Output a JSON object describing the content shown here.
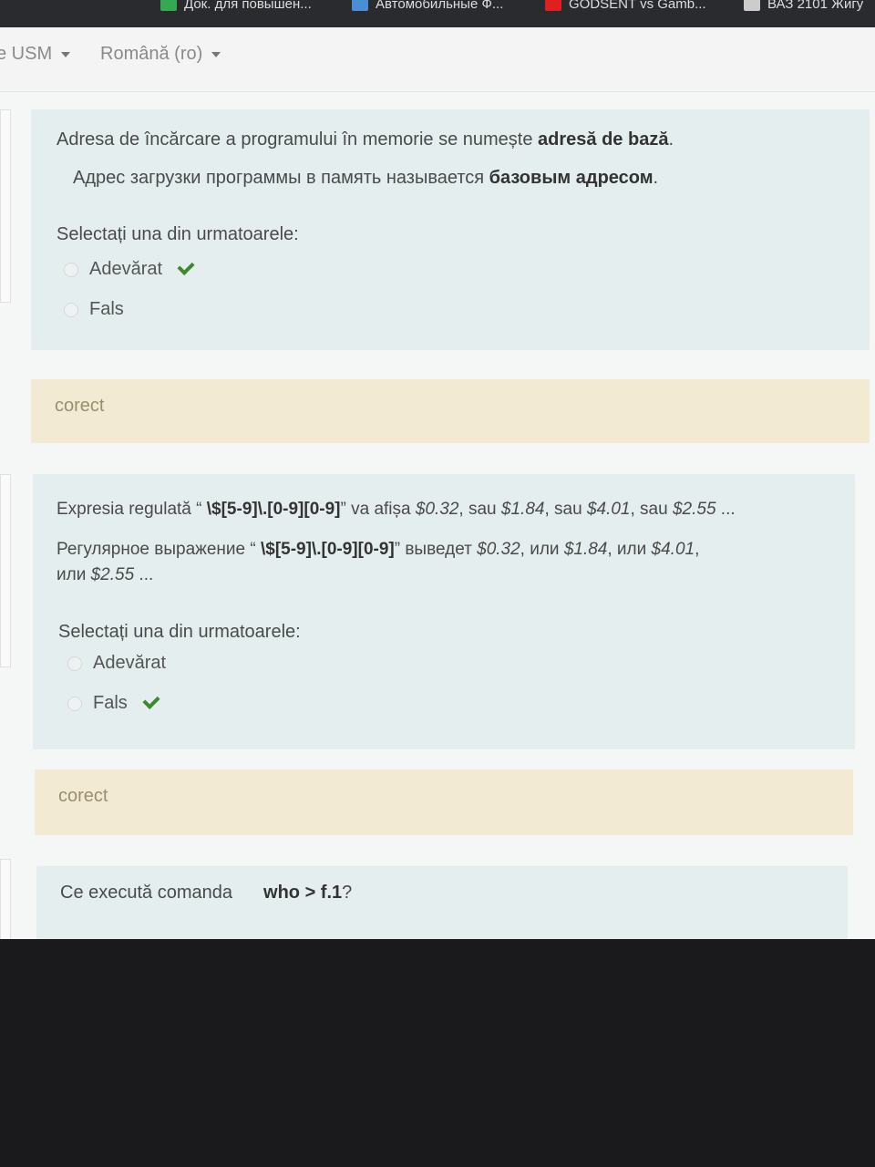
{
  "bookmarks": [
    {
      "label": "Док. для повышен...",
      "color": "#35a853",
      "icon": "checkmark-icon"
    },
    {
      "label": "Автомобильные Ф...",
      "color": "#4a8fd6",
      "icon": "page-icon"
    },
    {
      "label": "GODSENT vs Gamb...",
      "color": "#e02020",
      "icon": "youtube-icon"
    },
    {
      "label": "ВАЗ 2101 Жигу",
      "color": "#cccccc",
      "icon": "page-icon"
    }
  ],
  "navbar": {
    "site_label": "e USM",
    "language": "Română (ro)"
  },
  "questions": [
    {
      "text_ro_pre": "Adresa de încărcare a programului în memorie se numește ",
      "text_ro_bold": "adresă de bază",
      "text_ro_post": ".",
      "text_ru_pre": "Адрес загрузки программы в память называется ",
      "text_ru_bold": "базовым адресом",
      "text_ru_post": ".",
      "prompt": "Selectați una din urmatoarele:",
      "options": [
        {
          "label": "Adevărat",
          "correct_mark": true
        },
        {
          "label": "Fals",
          "correct_mark": false
        }
      ],
      "feedback": "corect"
    },
    {
      "ro_pre": "Expresia regulată “ ",
      "ro_code": "\\$[5-9]\\.[0-9][0-9]",
      "ro_mid": "” va afișa ",
      "ro_v1": "$0.32",
      "ro_s1": ", sau ",
      "ro_v2": "$1.84",
      "ro_s2": ", sau ",
      "ro_v3": "$4.01",
      "ro_s3": ", sau ",
      "ro_v4": "$2.55",
      "ro_end": " ...",
      "ru_pre": "Регулярное выражение “ ",
      "ru_code": "\\$[5-9]\\.[0-9][0-9]",
      "ru_mid": "” выведет ",
      "ru_v1": "$0.32",
      "ru_s1": ", или ",
      "ru_v2": "$1.84",
      "ru_s2": ", или ",
      "ru_v3": "$4.01",
      "ru_s3": ",",
      "ru_l2_pre": "или ",
      "ru_v4": "$2.55",
      "ru_end": " ...",
      "prompt": "Selectați una din urmatoarele:",
      "options": [
        {
          "label": "Adevărat",
          "correct_mark": false
        },
        {
          "label": "Fals",
          "correct_mark": true
        }
      ],
      "feedback": "corect"
    },
    {
      "text_pre": "Ce execută comanda",
      "text_cmd": "who > f.1",
      "text_post": "?"
    }
  ],
  "colors": {
    "question_bg": "#e5eeee",
    "feedback_bg": "#f2ead3",
    "check": "#3c8a2e"
  }
}
